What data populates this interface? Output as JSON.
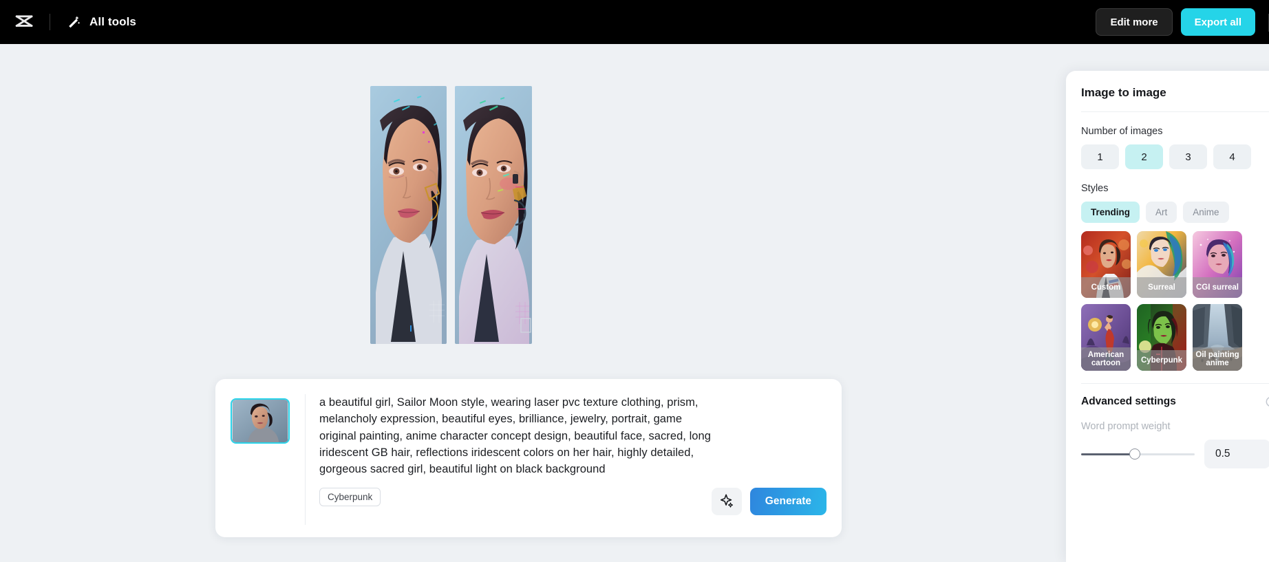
{
  "topbar": {
    "logo_icon": "capcut-logo-icon",
    "wand_icon": "magic-wand-icon",
    "all_tools_label": "All tools",
    "edit_more_label": "Edit more",
    "export_all_label": "Export all",
    "background_color": "#000000",
    "export_accent_color": "#25d4e8"
  },
  "canvas": {
    "results": [
      {
        "name": "generated-image-1",
        "alt": "cyberpunk portrait of a woman, variation 1"
      },
      {
        "name": "generated-image-2",
        "alt": "cyberpunk portrait of a woman, variation 2"
      }
    ]
  },
  "prompt": {
    "thumbnail_alt": "source reference portrait",
    "text": "a beautiful girl, Sailor Moon style, wearing laser pvc texture clothing, prism, melancholy expression, beautiful eyes, brilliance, jewelry, portrait, game original painting, anime character concept design, beautiful face, sacred, long iridescent GB hair, reflections iridescent colors on her hair, highly detailed, gorgeous sacred girl, beautiful light on black background",
    "tag": "Cyberpunk",
    "sparkle_icon": "sparkle-icon",
    "generate_label": "Generate",
    "generate_color_start": "#2e86de",
    "generate_color_end": "#2bb6e9"
  },
  "panel": {
    "title": "Image to image",
    "number_of_images": {
      "label": "Number of images",
      "options": [
        "1",
        "2",
        "3",
        "4"
      ],
      "selected": "2",
      "selected_color": "#c6f1f2"
    },
    "styles": {
      "label": "Styles",
      "tabs": [
        {
          "label": "Trending",
          "active": true
        },
        {
          "label": "Art",
          "active": false
        },
        {
          "label": "Anime",
          "active": false
        }
      ],
      "cards": [
        {
          "label": "Custom",
          "selected": false
        },
        {
          "label": "Surreal",
          "selected": false
        },
        {
          "label": "CGI surreal",
          "selected": false
        },
        {
          "label": "American cartoon",
          "selected": false
        },
        {
          "label": "Cyberpunk",
          "selected": true
        },
        {
          "label": "Oil painting anime",
          "selected": false
        }
      ],
      "selected_border_color": "#2ad4ea"
    },
    "advanced": {
      "title": "Advanced settings",
      "reset_icon": "reset-icon",
      "word_prompt_weight_label": "Word prompt weight",
      "word_prompt_weight_value": "0.5"
    }
  }
}
